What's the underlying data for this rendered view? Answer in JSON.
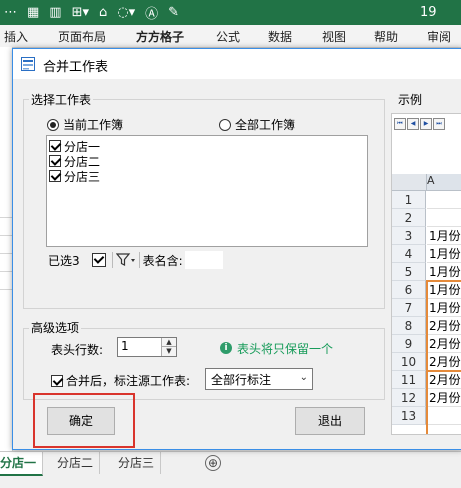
{
  "excel": {
    "title_suffix": "19",
    "ribbon_tabs": [
      "插入",
      "页面布局",
      "方方格子",
      "公式",
      "数据",
      "视图",
      "帮助",
      "审阅"
    ],
    "sheet_tabs": [
      "分店一",
      "分店二",
      "分店三"
    ],
    "add_sheet_icon": "⊕"
  },
  "dialog": {
    "title": "合并工作表",
    "select_group_label": "选择工作表",
    "radio_current": "当前工作簿",
    "radio_all": "全部工作簿",
    "sheets": [
      "分店一",
      "分店二",
      "分店三"
    ],
    "selected_count": "已选3",
    "table_name_label": "表名含:",
    "table_name_value": "",
    "advanced_label": "高级选项",
    "header_rows_label": "表头行数:",
    "header_rows_value": "1",
    "info_text": "表头将只保留一个",
    "mark_source_label": "合并后，标注源工作表:",
    "mark_source_value": "全部行标注",
    "ok_label": "确定",
    "exit_label": "退出",
    "example_label": "示例",
    "example_col_header": "A",
    "example_rows": [
      {
        "n": "1",
        "v": ""
      },
      {
        "n": "2",
        "v": ""
      },
      {
        "n": "3",
        "v": "1月份"
      },
      {
        "n": "4",
        "v": "1月份"
      },
      {
        "n": "5",
        "v": "1月份"
      },
      {
        "n": "6",
        "v": "1月份"
      },
      {
        "n": "7",
        "v": "1月份"
      },
      {
        "n": "8",
        "v": "2月份"
      },
      {
        "n": "9",
        "v": "2月份"
      },
      {
        "n": "10",
        "v": "2月份"
      },
      {
        "n": "11",
        "v": "2月份"
      },
      {
        "n": "12",
        "v": "2月份"
      },
      {
        "n": "13",
        "v": ""
      }
    ]
  },
  "colors": {
    "excel_green": "#217346",
    "info_green": "#169b59",
    "highlight_orange": "#e58a3a",
    "annotation_red": "#d9342c"
  }
}
